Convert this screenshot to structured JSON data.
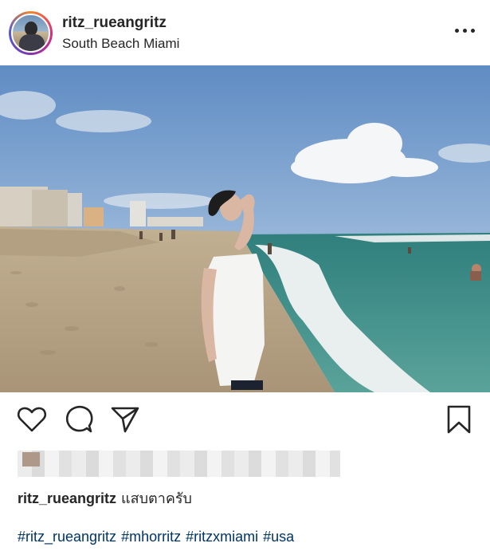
{
  "post": {
    "username": "ritz_rueangritz",
    "location": "South Beach Miami"
  },
  "caption": {
    "username": "ritz_rueangritz",
    "text": "แสบตาครับ"
  },
  "hashtags": [
    "#ritz_rueangritz",
    "#mhorritz",
    "#ritzxmiami",
    "#usa"
  ],
  "icons": {
    "more": "more-options-icon",
    "like": "heart-icon",
    "comment": "comment-bubble-icon",
    "share": "paper-plane-icon",
    "save": "bookmark-icon"
  },
  "colors": {
    "text": "#262626",
    "hashtag": "#003569",
    "sky": "#6f9bd0",
    "sea": "#3f8f88",
    "sand": "#b8a587"
  }
}
